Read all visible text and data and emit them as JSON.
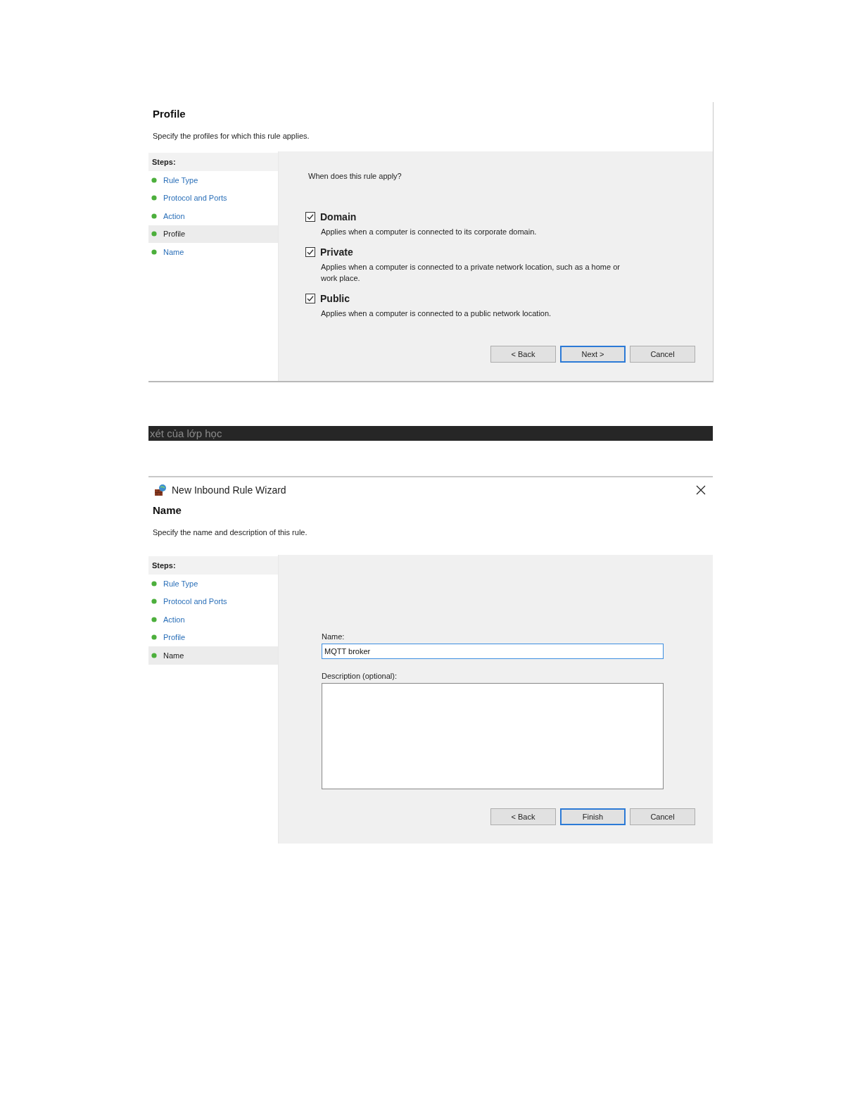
{
  "dialogs": [
    {
      "kind": "profile",
      "heading": "Profile",
      "subtitle": "Specify the profiles for which this rule applies.",
      "steps_title": "Steps:",
      "steps": [
        {
          "label": "Rule Type",
          "selected": false
        },
        {
          "label": "Protocol and Ports",
          "selected": false
        },
        {
          "label": "Action",
          "selected": false
        },
        {
          "label": "Profile",
          "selected": true
        },
        {
          "label": "Name",
          "selected": false
        }
      ],
      "question": "When does this rule apply?",
      "options": [
        {
          "label": "Domain",
          "checked": true,
          "description": "Applies when a computer is connected to its corporate domain."
        },
        {
          "label": "Private",
          "checked": true,
          "description": "Applies when a computer is connected to a private network location, such as a home or work place."
        },
        {
          "label": "Public",
          "checked": true,
          "description": "Applies when a computer is connected to a public network location."
        }
      ],
      "buttons": [
        {
          "label": "< Back",
          "default": false
        },
        {
          "label": "Next >",
          "default": true
        },
        {
          "label": "Cancel",
          "default": false
        }
      ]
    },
    {
      "kind": "separator",
      "text": "xét của lớp học"
    },
    {
      "kind": "name",
      "window_title": "New Inbound Rule Wizard",
      "heading": "Name",
      "subtitle": "Specify the name and description of this rule.",
      "steps_title": "Steps:",
      "steps": [
        {
          "label": "Rule Type",
          "selected": false
        },
        {
          "label": "Protocol and Ports",
          "selected": false
        },
        {
          "label": "Action",
          "selected": false
        },
        {
          "label": "Profile",
          "selected": false
        },
        {
          "label": "Name",
          "selected": true
        }
      ],
      "name_label": "Name:",
      "name_value": "MQTT broker",
      "description_label": "Description (optional):",
      "buttons": [
        {
          "label": "< Back",
          "default": false
        },
        {
          "label": "Finish",
          "default": true
        },
        {
          "label": "Cancel",
          "default": false
        }
      ]
    }
  ]
}
